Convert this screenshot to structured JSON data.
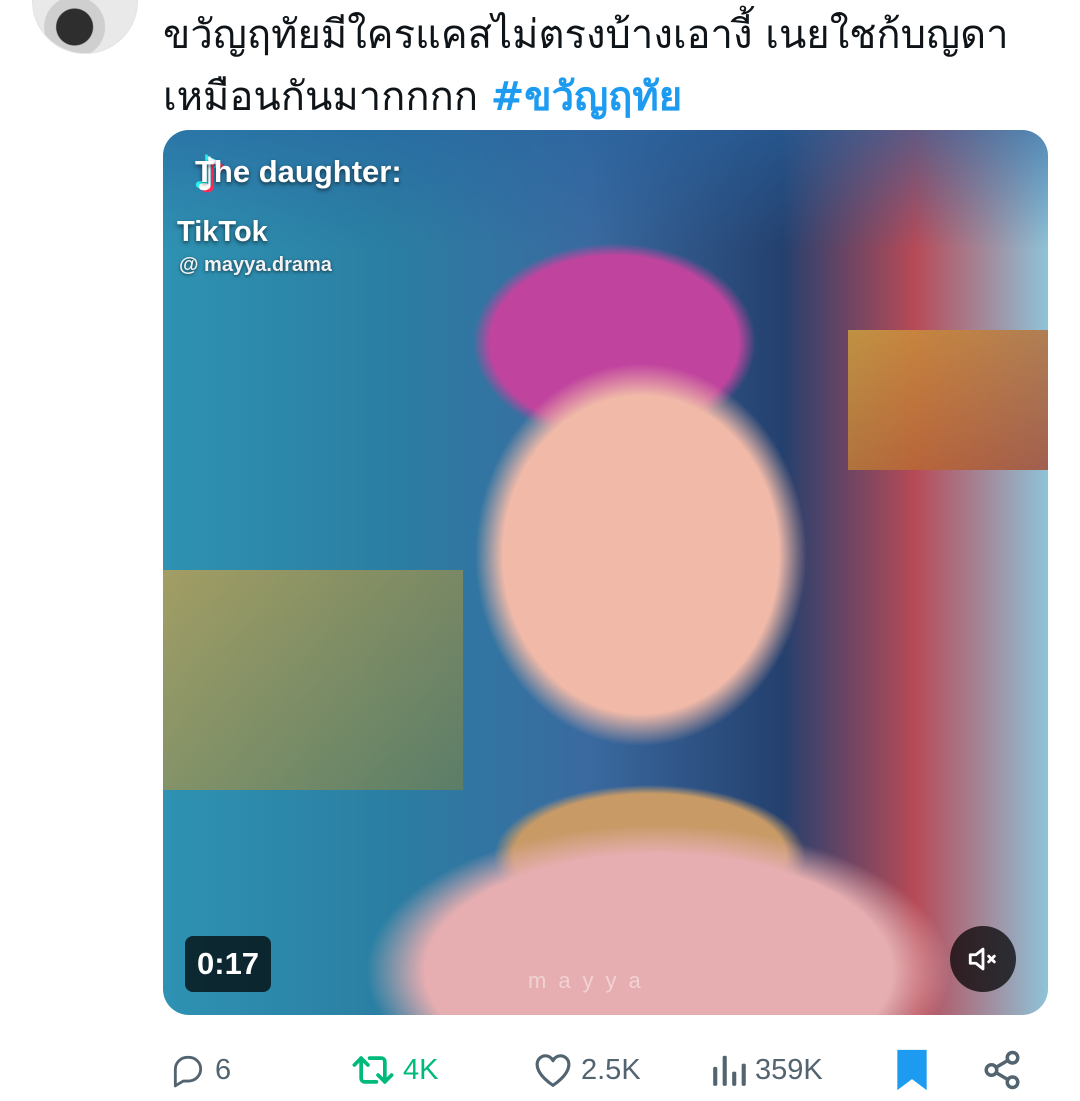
{
  "tweet": {
    "text": "ขวัญฤทัยมีใครแคสไม่ตรงบ้างเอางี้ เนยใชก้บญดาเหมือนกันมากกกก",
    "hashtag": "#ขวัญฤทัย"
  },
  "media": {
    "overlay_title": "The daughter:",
    "overlay_brand": "TikTok",
    "overlay_handle": "@ mayya.drama",
    "watermark": "mayya",
    "duration": "0:17",
    "mute_icon": "muted-speaker-icon"
  },
  "actions": {
    "replies": "6",
    "retweets": "4K",
    "likes": "2.5K",
    "views": "359K"
  },
  "colors": {
    "text": "#0f1419",
    "hashtag": "#1d9bf0",
    "muted": "#536471",
    "retweet_active": "#00ba7c",
    "bookmark_active": "#1d9bf0"
  }
}
